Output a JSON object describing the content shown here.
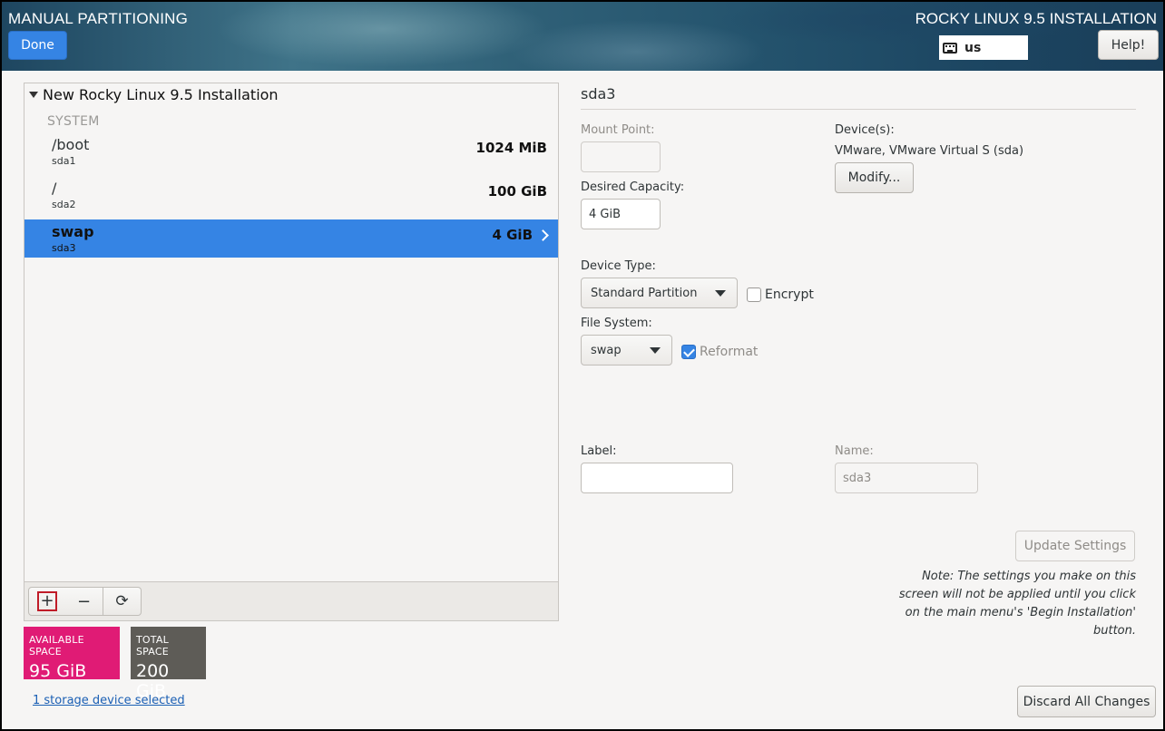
{
  "header": {
    "title": "MANUAL PARTITIONING",
    "product": "ROCKY LINUX 9.5 INSTALLATION",
    "done_label": "Done",
    "keyboard_layout": "us",
    "help_label": "Help!"
  },
  "tree": {
    "root_label": "New Rocky Linux 9.5 Installation",
    "section_label": "SYSTEM",
    "mountpoints": [
      {
        "name": "/boot",
        "device": "sda1",
        "size": "1024 MiB"
      },
      {
        "name": "/",
        "device": "sda2",
        "size": "100 GiB"
      },
      {
        "name": "swap",
        "device": "sda3",
        "size": "4 GiB",
        "selected": true
      }
    ]
  },
  "toolbar": {
    "add_symbol": "+",
    "remove_symbol": "−",
    "refresh_symbol": "⟳"
  },
  "space": {
    "available_label": "AVAILABLE SPACE",
    "available_value": "95 GiB",
    "available_color": "#e01b75",
    "total_label": "TOTAL SPACE",
    "total_value": "200 GiB"
  },
  "storage_link": "1 storage device selected",
  "details": {
    "title": "sda3",
    "mount_point_label": "Mount Point:",
    "mount_point_value": "",
    "desired_capacity_label": "Desired Capacity:",
    "desired_capacity_value": "4 GiB",
    "devices_label": "Device(s):",
    "devices_value": "VMware, VMware Virtual S (sda)",
    "modify_label": "Modify...",
    "device_type_label": "Device Type:",
    "device_type_value": "Standard Partition",
    "encrypt_label": "Encrypt",
    "encrypt_checked": false,
    "file_system_label": "File System:",
    "file_system_value": "swap",
    "reformat_label": "Reformat",
    "reformat_checked": true,
    "label_label": "Label:",
    "label_value": "",
    "name_label": "Name:",
    "name_value": "sda3",
    "update_label": "Update Settings",
    "note": "Note:  The settings you make on this screen will not be applied until you click on the main menu's 'Begin Installation' button.",
    "discard_label": "Discard All Changes"
  },
  "colors": {
    "accent": "#3584e4",
    "available_space": "#e01b75",
    "total_space": "#5e5c57"
  }
}
